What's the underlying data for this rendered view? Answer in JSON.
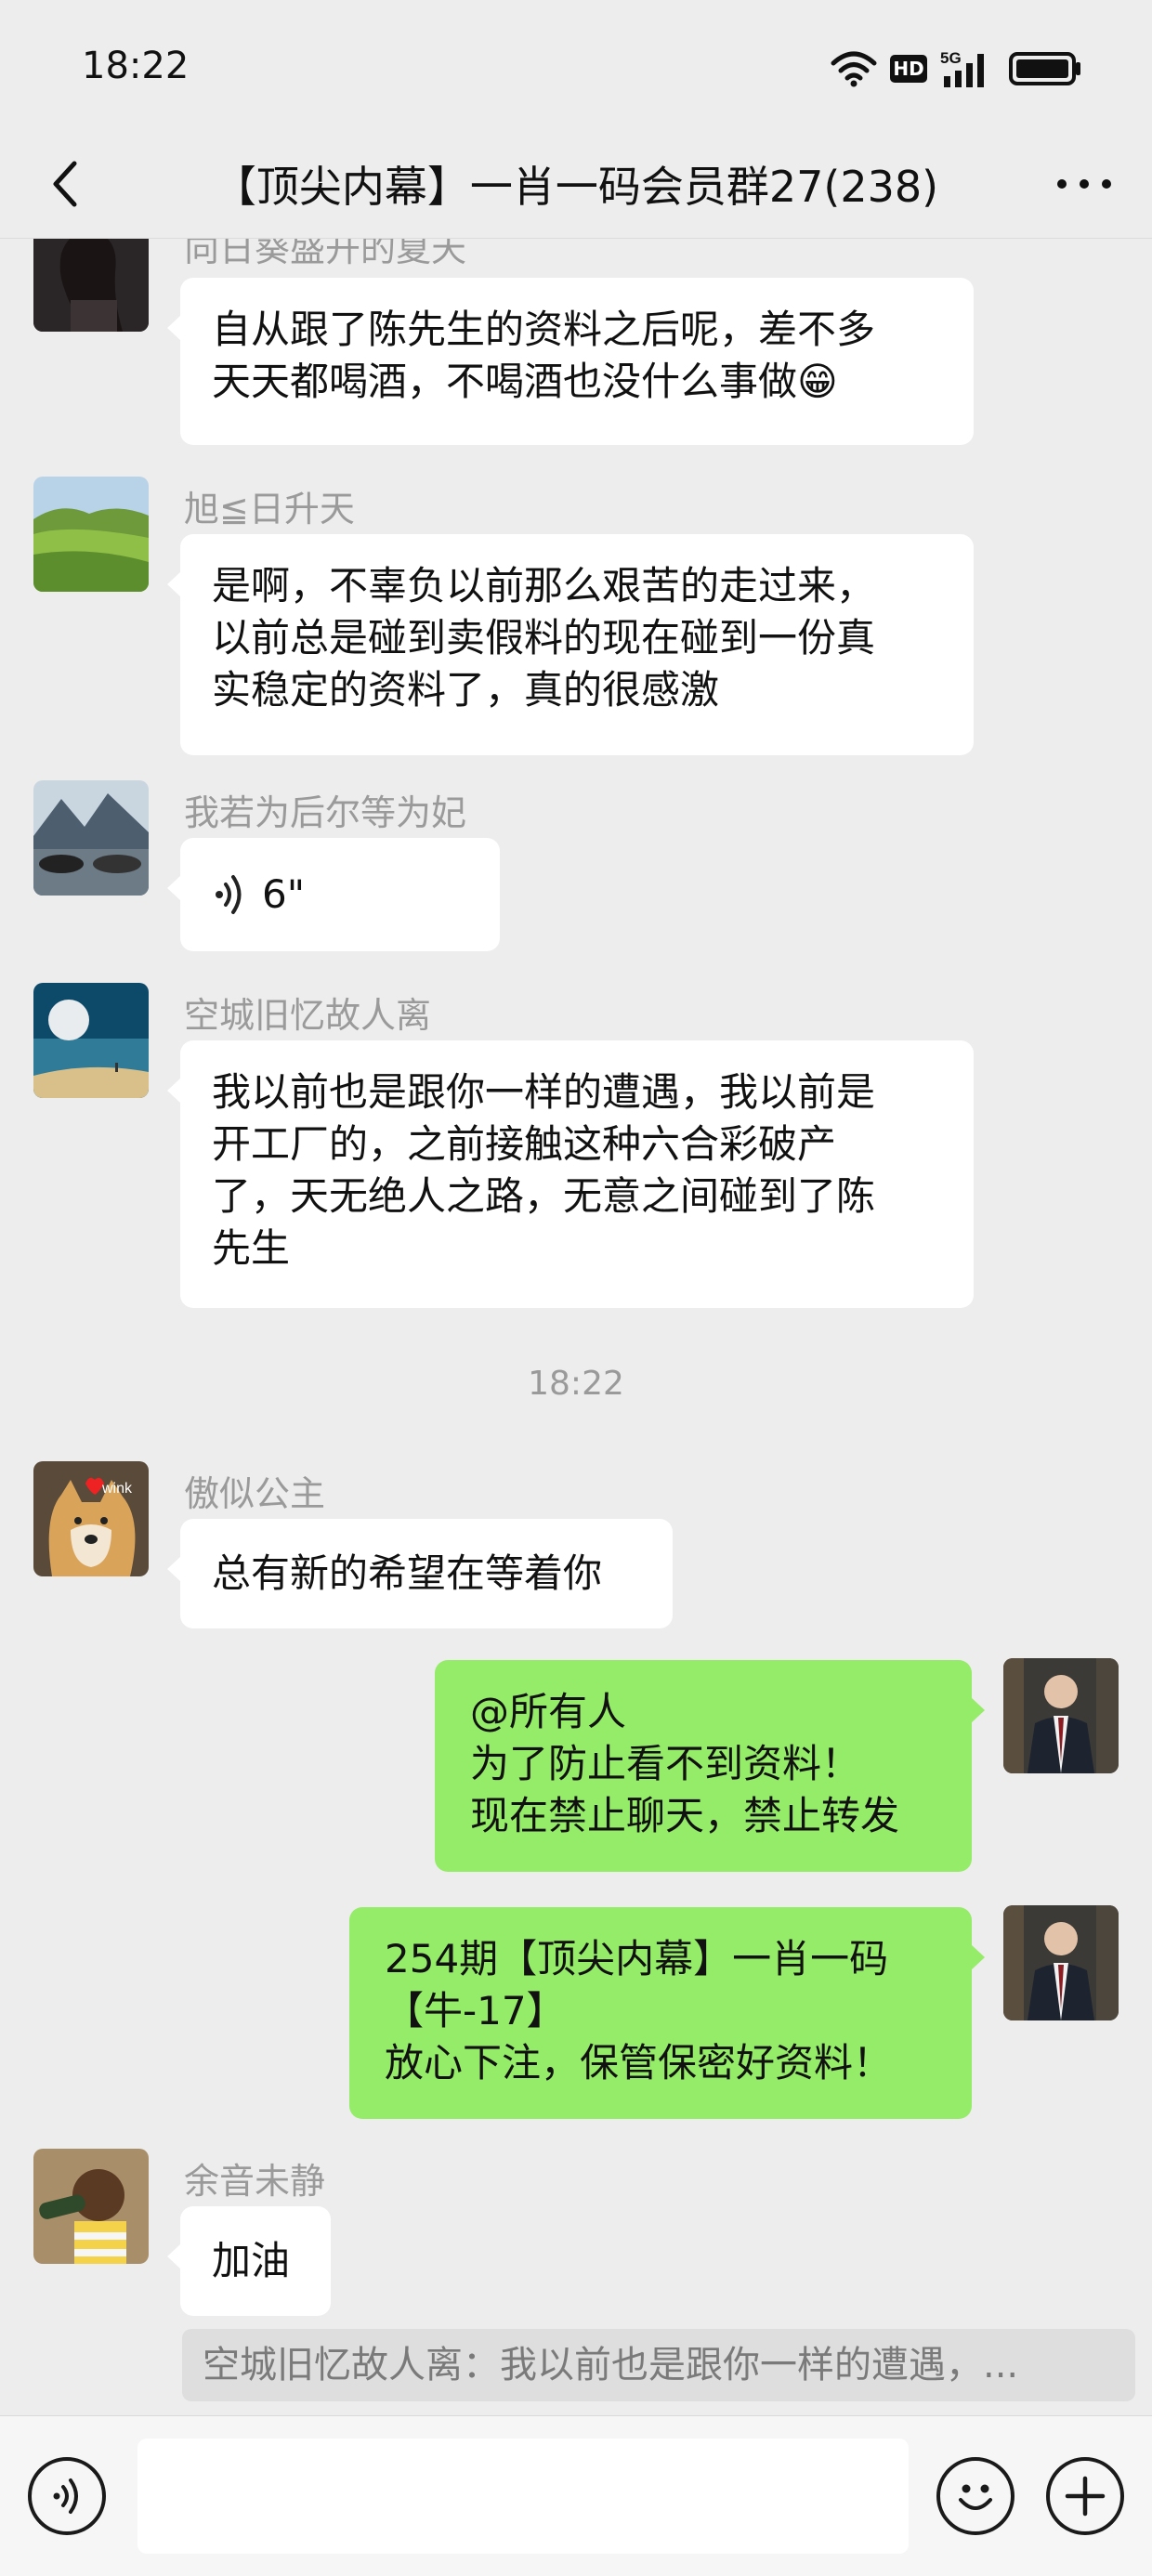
{
  "status_bar": {
    "time": "18:22",
    "hd_label": "HD",
    "network_label": "5G",
    "icons": [
      "wifi-icon",
      "hd-icon",
      "5g-signal-icon",
      "battery-icon"
    ]
  },
  "nav": {
    "title": "【顶尖内幕】一肖一码会员群27(238)",
    "back_icon": "back-chevron-icon",
    "more_icon": "more-dots-icon"
  },
  "messages": [
    {
      "sender": "向日葵盛开的夏天",
      "lines": [
        "自从跟了陈先生的资料之后呢，差不多",
        "天天都喝酒，不喝酒也没什么事做"
      ],
      "emoji": "😁"
    },
    {
      "sender": "旭≦日升天",
      "lines": [
        "是啊，不辜负以前那么艰苦的走过来，",
        "以前总是碰到卖假料的现在碰到一份真",
        "实稳定的资料了，真的很感激"
      ]
    },
    {
      "sender": "我若为后尔等为妃",
      "voice_duration": "6\""
    },
    {
      "sender": "空城旧忆故人离",
      "lines": [
        "我以前也是跟你一样的遭遇，我以前是",
        "开工厂的，之前接触这种六合彩破产",
        "了，天无绝人之路，无意之间碰到了陈",
        "先生"
      ]
    },
    {
      "timestamp": "18:22"
    },
    {
      "sender": "傲似公主",
      "avatar_text": "wink",
      "lines": [
        "总有新的希望在等着你"
      ]
    },
    {
      "outgoing": true,
      "lines": [
        "@所有人",
        "为了防止看不到资料！",
        "现在禁止聊天，禁止转发"
      ]
    },
    {
      "outgoing": true,
      "lines": [
        "254期【顶尖内幕】一肖一码",
        "【牛-17】",
        "放心下注，保管保密好资料！"
      ]
    },
    {
      "sender": "余音未静",
      "lines": [
        "加油"
      ]
    }
  ],
  "quote": "空城旧忆故人离：我以前也是跟你一样的遭遇，...",
  "input_bar": {
    "icons": [
      "voice-input-icon",
      "emoji-icon",
      "plus-icon"
    ],
    "input_value": ""
  }
}
